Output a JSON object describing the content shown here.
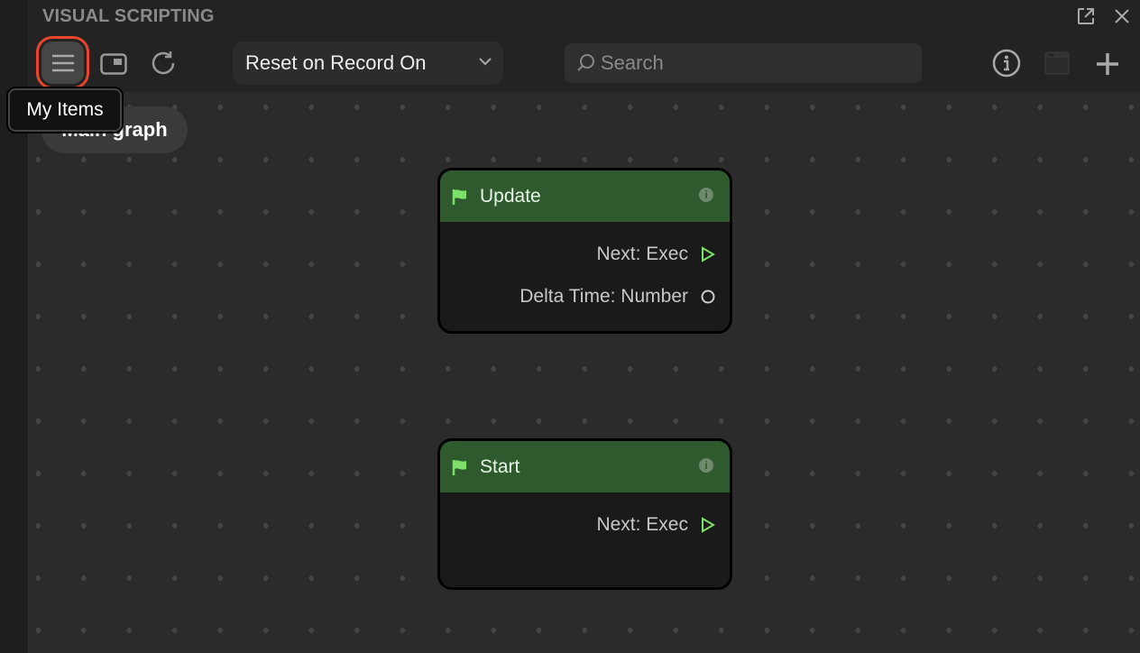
{
  "panel": {
    "title": "VISUAL SCRIPTING"
  },
  "toolbar": {
    "dropdown_value": "Reset on Record On",
    "search_placeholder": "Search",
    "tooltip": "My Items"
  },
  "breadcrumb": {
    "label": "Main graph"
  },
  "nodes": [
    {
      "title": "Update",
      "ports": [
        {
          "label": "Next: Exec",
          "type": "exec"
        },
        {
          "label": "Delta Time: Number",
          "type": "number"
        }
      ]
    },
    {
      "title": "Start",
      "ports": [
        {
          "label": "Next: Exec",
          "type": "exec"
        }
      ]
    }
  ],
  "colors": {
    "accent_highlight": "#e8452c",
    "node_header": "#2f5a2e",
    "exec_port": "#7ee06a"
  }
}
